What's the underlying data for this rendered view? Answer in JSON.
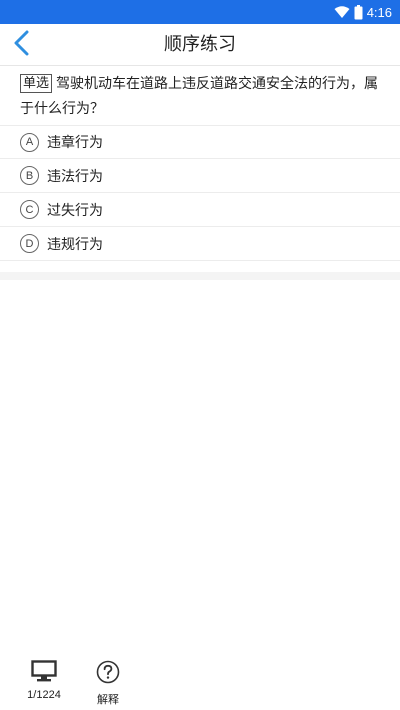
{
  "status_bar": {
    "time": "4:16",
    "icons": [
      "wifi-icon",
      "battery-icon"
    ],
    "color": "#1e6fe6"
  },
  "nav": {
    "title": "顺序练习",
    "back_icon": "chevron-left-icon",
    "accent": "#2f8fe0"
  },
  "question": {
    "type": "单选",
    "text": "驾驶机动车在道路上违反道路交通安全法的行为，属于什么行为？"
  },
  "options": [
    {
      "letter": "A",
      "text": "违章行为"
    },
    {
      "letter": "B",
      "text": "违法行为"
    },
    {
      "letter": "C",
      "text": "过失行为"
    },
    {
      "letter": "D",
      "text": "违规行为"
    }
  ],
  "bottom_bar": {
    "progress_label": "1/1224",
    "progress_icon": "monitor-icon",
    "explain_label": "解释",
    "explain_icon": "help-circle-icon"
  }
}
